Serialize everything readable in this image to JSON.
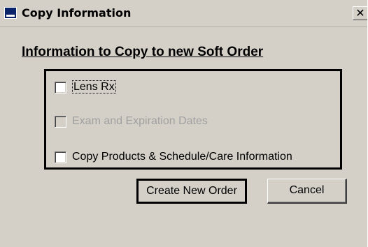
{
  "window": {
    "title": "Copy Information",
    "close_glyph": "✕"
  },
  "heading": "Information to Copy to new Soft Order",
  "options": [
    {
      "label": "Lens Rx",
      "checked": false,
      "enabled": true
    },
    {
      "label": "Exam and Expiration Dates",
      "checked": false,
      "enabled": false
    },
    {
      "label": "Copy Products & Schedule/Care Information",
      "checked": false,
      "enabled": true
    }
  ],
  "buttons": {
    "create_label": "Create New Order",
    "cancel_label": "Cancel"
  },
  "colors": {
    "dialog_bg": "#d4d0c8",
    "title_icon": "#0a246a",
    "disabled_text": "#a0a0a0"
  }
}
